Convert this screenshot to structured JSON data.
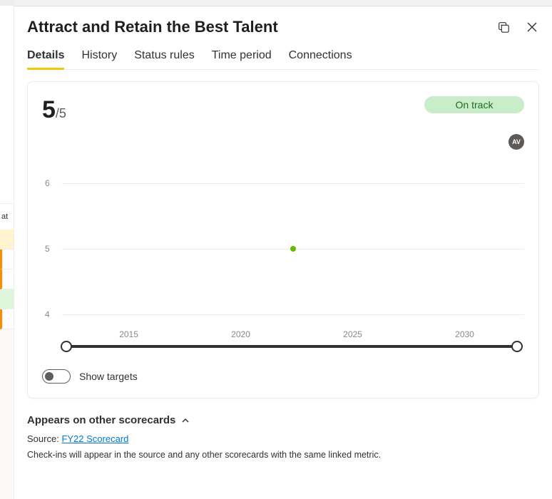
{
  "sidebar": {
    "truncated_label": "at"
  },
  "header": {
    "title": "Attract and Retain the Best Talent"
  },
  "tabs": [
    {
      "label": "Details",
      "active": true
    },
    {
      "label": "History",
      "active": false
    },
    {
      "label": "Status rules",
      "active": false
    },
    {
      "label": "Time period",
      "active": false
    },
    {
      "label": "Connections",
      "active": false
    }
  ],
  "metric": {
    "value": "5",
    "denominator": "/5",
    "status": "On track",
    "avatar_initials": "AV"
  },
  "chart_data": {
    "type": "scatter",
    "title": "",
    "xlabel": "",
    "ylabel": "",
    "x_ticks": [
      "2015",
      "2020",
      "2025",
      "2030"
    ],
    "y_ticks": [
      4,
      5,
      6
    ],
    "ylim": [
      4,
      6
    ],
    "xlim": [
      2012,
      2033
    ],
    "series": [
      {
        "name": "value",
        "x": [
          2022
        ],
        "values": [
          5
        ],
        "color": "#6bb700"
      }
    ]
  },
  "toggle": {
    "show_targets_label": "Show targets",
    "on": false
  },
  "appears": {
    "heading": "Appears on other scorecards",
    "source_label": "Source:",
    "source_link": "FY22 Scorecard",
    "note": "Check-ins will appear in the source and any other scorecards with the same linked metric."
  }
}
